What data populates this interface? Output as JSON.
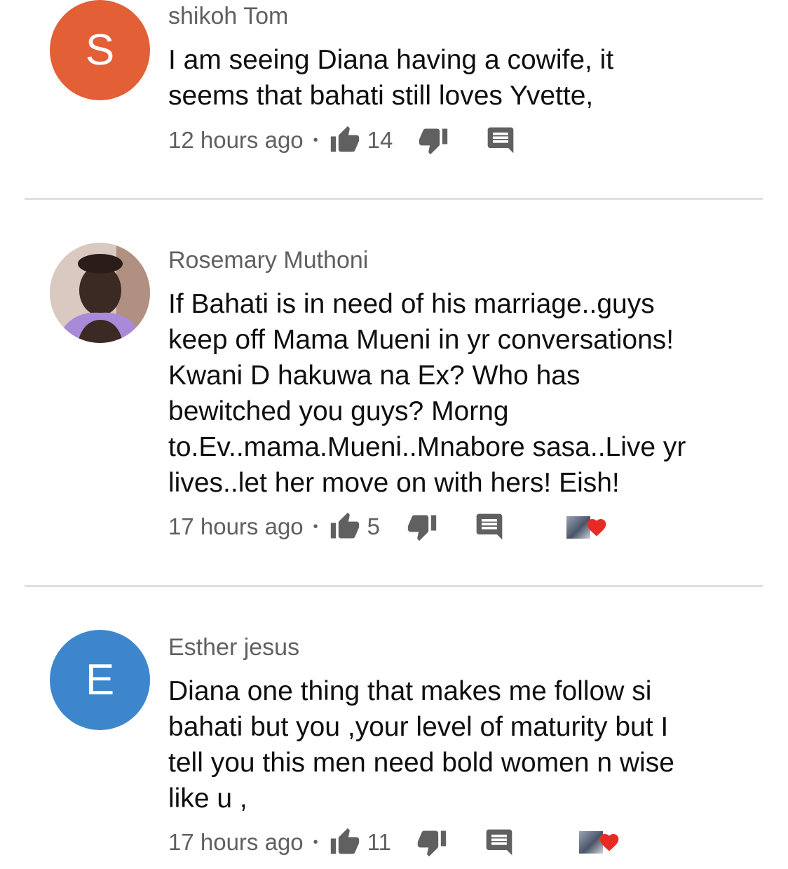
{
  "comments": [
    {
      "author": "shikoh Tom",
      "avatar_letter": "S",
      "avatar_color": "#e35f36",
      "text_lines": [
        "I am seeing Diana having a cowife, it",
        "seems that bahati still loves Yvette,"
      ],
      "time": "12 hours ago",
      "separator": "•",
      "likes": "14",
      "creator_heart": false
    },
    {
      "author": "Rosemary Muthoni",
      "avatar_letter": "",
      "avatar_color": "#d8c8c0",
      "text_lines": [
        "If Bahati is in need of his marriage..guys",
        "keep off Mama Mueni in yr conversations!",
        "Kwani D hakuwa na Ex? Who has",
        "bewitched you guys? Morng",
        "to.Ev..mama.Mueni..Mnabore sasa..Live yr",
        "lives..let her move on with hers! Eish!"
      ],
      "time": "17 hours ago",
      "separator": "•",
      "likes": "5",
      "creator_heart": true
    },
    {
      "author": "Esther jesus",
      "avatar_letter": "E",
      "avatar_color": "#3d86cc",
      "text_lines": [
        "Diana one thing that makes me follow si",
        "bahati but you ,your level of maturity but I",
        "tell you this men need bold women n wise",
        "like u ,"
      ],
      "time": "17 hours ago",
      "separator": "•",
      "likes": "11",
      "creator_heart": true
    }
  ],
  "icons": {
    "like": "thumbs-up-icon",
    "dislike": "thumbs-down-icon",
    "reply": "reply-comment-icon",
    "heart": "heart-icon"
  },
  "colors": {
    "icon": "#606060",
    "heart": "#e82a25",
    "divider": "#e0e0e0"
  }
}
